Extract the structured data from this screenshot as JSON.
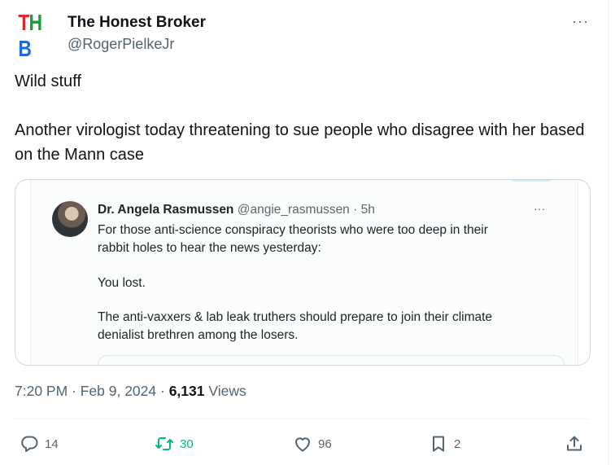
{
  "author": {
    "avatar_text": "THB",
    "avatar_letters": [
      {
        "char": "T",
        "color": "#e8262a"
      },
      {
        "char": "H",
        "color": "#1e9a3c"
      },
      {
        "char": "B",
        "color": "#1f6bd6"
      }
    ],
    "name": "The Honest Broker",
    "handle": "@RogerPielkeJr"
  },
  "more_label": "···",
  "tweet": {
    "line1": "Wild stuff",
    "line2": "Another virologist today threatening to sue people who disagree with her based on the Mann case"
  },
  "quoted": {
    "name": "Dr. Angela Rasmussen",
    "meta": "@angie_rasmussen · 5h",
    "more_label": "···",
    "lines": [
      "For those anti-science conspiracy theorists who were too deep in their",
      "rabbit holes to hear the news yesterday:",
      "You lost.",
      "The anti-vaxxers & lab leak truthers should prepare to join their climate",
      "denialist brethren among the losers."
    ]
  },
  "meta": {
    "time_date": "7:20 PM · Feb 9, 2024 · ",
    "views_count": "6,131",
    "views_label": " Views"
  },
  "actions": {
    "replies": "14",
    "reposts": "30",
    "likes": "96",
    "bookmarks": "2"
  },
  "colors": {
    "text": "#0f1419",
    "secondary": "#536471",
    "repost_active": "#00ba7c",
    "border": "#cfd9de"
  },
  "icons": [
    "reply-icon",
    "repost-icon",
    "like-icon",
    "bookmark-icon",
    "share-icon",
    "more-icon"
  ]
}
